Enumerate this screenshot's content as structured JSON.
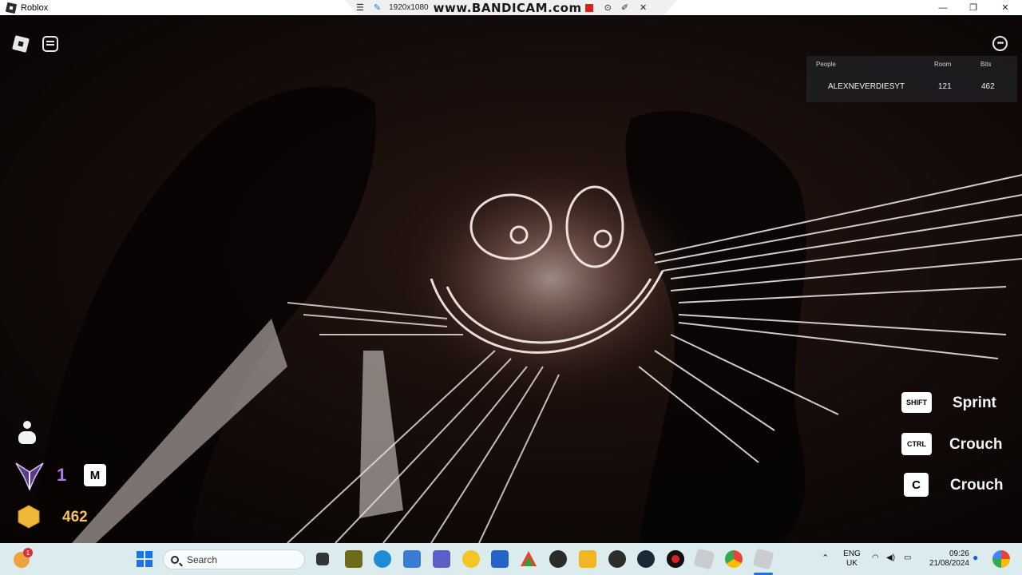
{
  "window": {
    "title": "Roblox",
    "controls": {
      "minimize": "—",
      "maximize": "❐",
      "close": "✕"
    }
  },
  "bandicam": {
    "menu_icon": "hamburger-icon",
    "pin_icon": "pin-icon",
    "resolution": "1920x1080",
    "brand": "www.BANDICAM.com",
    "icons": [
      "record-icon",
      "camera-icon",
      "pencil-icon",
      "close-icon"
    ]
  },
  "game": {
    "leaderboard": {
      "headers": {
        "people": "People",
        "room": "Room",
        "bits": "Bits"
      },
      "rows": [
        {
          "name": "ALEXNEVERDIESYT",
          "room": "121",
          "bits": "462"
        }
      ]
    },
    "hud": {
      "rank_number": "1",
      "map_key": "M",
      "coins": "462",
      "rank_color": "#b07cdc",
      "coin_color": "#f2c35a"
    },
    "keybinds": [
      {
        "key": "SHIFT",
        "action": "Sprint"
      },
      {
        "key": "CTRL",
        "action": "Crouch"
      },
      {
        "key": "C",
        "action": "Crouch"
      }
    ]
  },
  "taskbar": {
    "search_placeholder": "Search",
    "weather_badge": "1",
    "language": {
      "line1": "ENG",
      "line2": "UK"
    },
    "time": "09:26",
    "date": "21/08/2024",
    "apps": [
      "windows-start-icon",
      "search-box",
      "widgets-icon",
      "task-view-icon",
      "file-tab-icon",
      "edge-icon",
      "calculator-icon",
      "teams-icon",
      "emoji-app-icon",
      "store-icon",
      "colorful-triangle-icon",
      "game-controller-icon",
      "file-explorer-icon",
      "obs-icon",
      "steam-icon",
      "bandicam-rec-icon",
      "roblox-studio-icon",
      "chrome-icon",
      "roblox-icon"
    ]
  }
}
